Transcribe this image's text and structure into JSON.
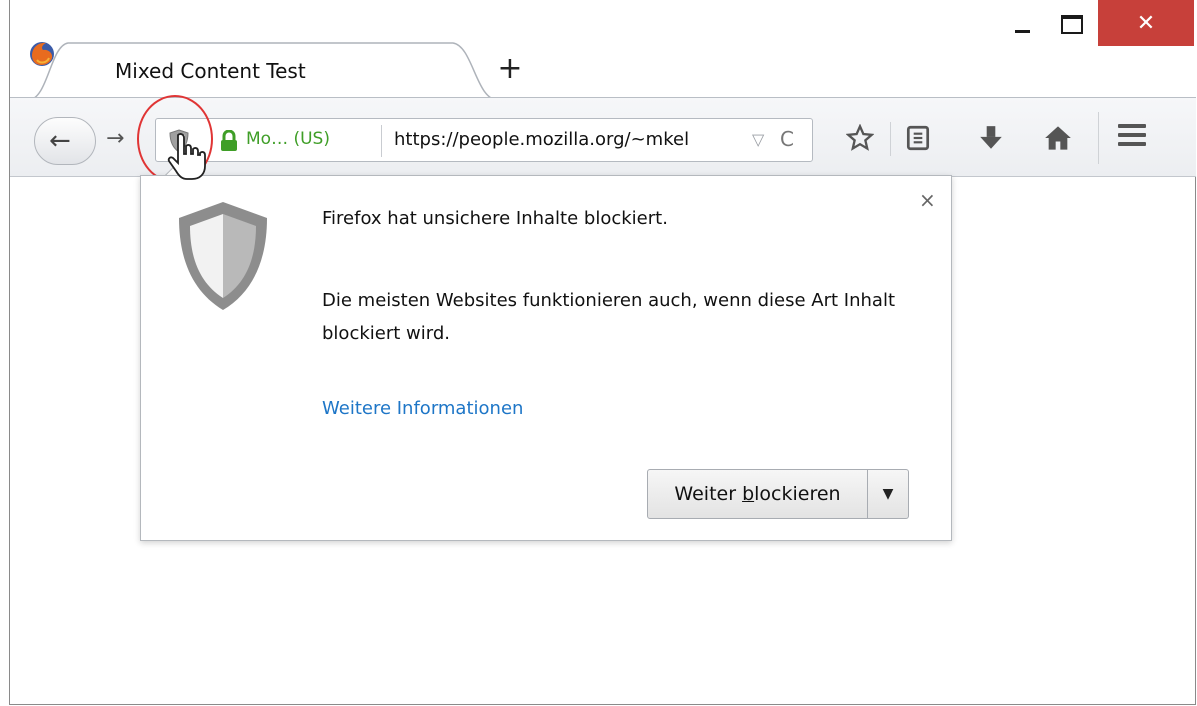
{
  "window": {
    "close_glyph": "✕",
    "minimize_glyph": "–",
    "maximize_glyph": "□"
  },
  "tab": {
    "title": "Mixed Content Test",
    "new_tab_glyph": "+"
  },
  "urlbar": {
    "identity_org": "Mo… (US)",
    "url": "https://people.mozilla.org/~mkel",
    "dropdown_glyph": "▽",
    "reload_glyph": "C"
  },
  "toolbar": {
    "back_glyph": "←",
    "forward_glyph": "→",
    "icons": [
      "star-icon",
      "reader-icon",
      "download-icon",
      "home-icon",
      "menu-icon"
    ]
  },
  "popup": {
    "heading": "Firefox hat unsichere Inhalte blockiert.",
    "body": "Die meisten Websites funktionieren auch, wenn diese Art Inhalt blockiert wird.",
    "link": "Weitere Informationen",
    "button_pre": "Weiter ",
    "button_underlined": "b",
    "button_post": "lockieren",
    "dropdown_glyph": "▼",
    "close_glyph": "×"
  },
  "colors": {
    "secure_green": "#3f9e27",
    "link_blue": "#1e76c7",
    "close_red": "#c7403a",
    "highlight_red": "#e03535"
  }
}
